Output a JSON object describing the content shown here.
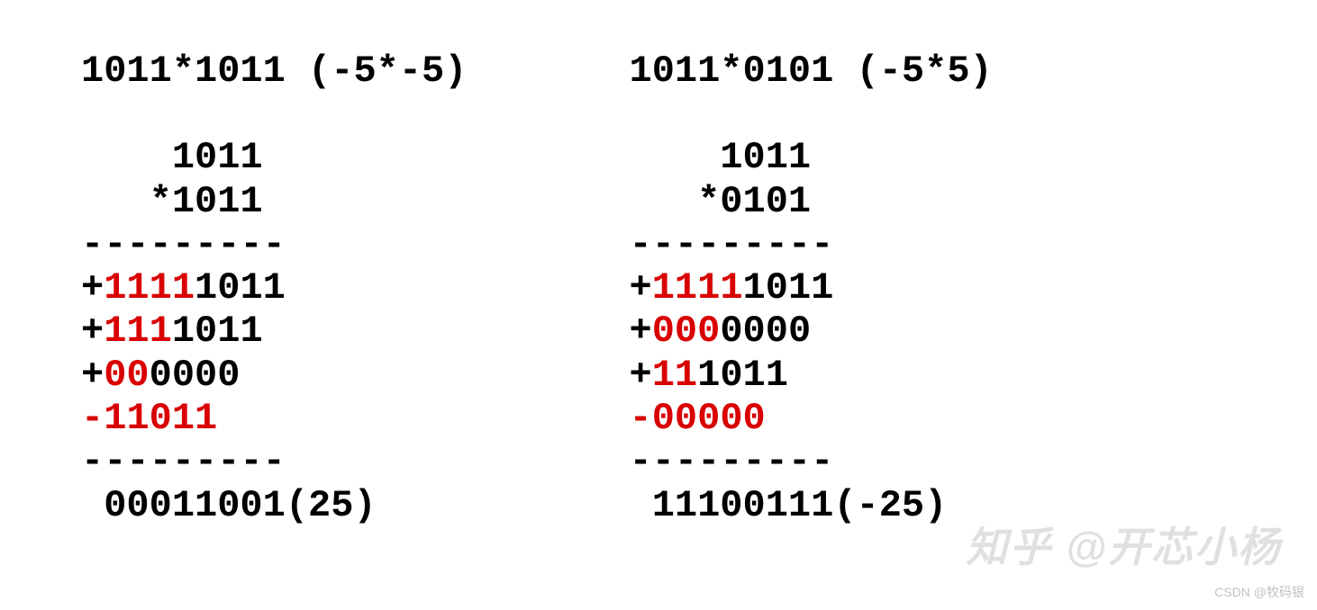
{
  "left": {
    "title": "1011*1011 (-5*-5)",
    "multiplicand": "    1011",
    "multiplier": "   *1011",
    "divider": "---------",
    "pp1_sign": "+",
    "pp1_ext": "1111",
    "pp1_val": "1011",
    "pp2_sign": "+",
    "pp2_ext": "111",
    "pp2_val": "1011",
    "pp3_sign": "+",
    "pp3_ext": "00",
    "pp3_val": "0000",
    "pp4_sign": "-",
    "pp4_ext": "1",
    "pp4_val": "1011",
    "result": " 00011001(25)"
  },
  "right": {
    "title": "1011*0101 (-5*5)",
    "multiplicand": "    1011",
    "multiplier": "   *0101",
    "divider": "---------",
    "pp1_sign": "+",
    "pp1_ext": "1111",
    "pp1_val": "1011",
    "pp2_sign": "+",
    "pp2_ext": "000",
    "pp2_val": "0000",
    "pp3_sign": "+",
    "pp3_ext": "11",
    "pp3_val": "1011",
    "pp4_sign": "-",
    "pp4_ext": "0",
    "pp4_val": "0000",
    "result": " 11100111(-25)"
  },
  "watermark_zhihu": "知乎 @开芯小杨",
  "watermark_csdn": "CSDN @牧码银"
}
